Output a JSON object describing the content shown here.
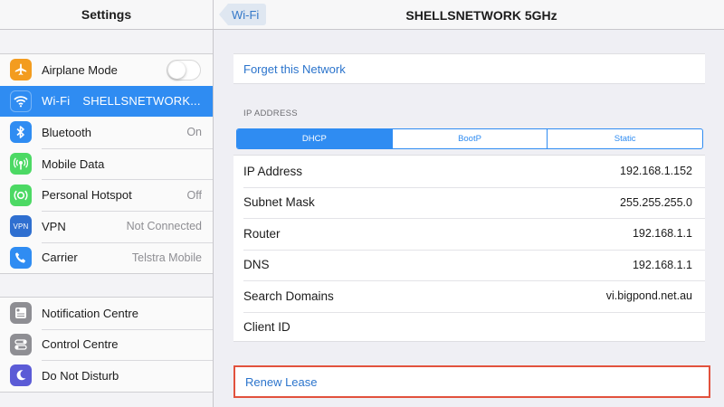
{
  "sidebar": {
    "title": "Settings",
    "group1": [
      {
        "label": "Airplane Mode",
        "icon": "airplane-icon",
        "color": "#f39c1f",
        "value": "",
        "toggle": true
      },
      {
        "label": "Wi-Fi",
        "icon": "wifi-icon",
        "color": "#2f8cf2",
        "value": "SHELLSNETWORK...",
        "selected": true
      },
      {
        "label": "Bluetooth",
        "icon": "bluetooth-icon",
        "color": "#2f8cf2",
        "value": "On"
      },
      {
        "label": "Mobile Data",
        "icon": "mobile-data-icon",
        "color": "#4cd964",
        "value": ""
      },
      {
        "label": "Personal Hotspot",
        "icon": "hotspot-icon",
        "color": "#4cd964",
        "value": "Off"
      },
      {
        "label": "VPN",
        "icon": "vpn-icon",
        "color": "#2f6fd0",
        "value": "Not Connected"
      },
      {
        "label": "Carrier",
        "icon": "phone-icon",
        "color": "#2f8cf2",
        "value": "Telstra Mobile"
      }
    ],
    "group2": [
      {
        "label": "Notification Centre",
        "icon": "notification-centre-icon",
        "color": "#8e8e93"
      },
      {
        "label": "Control Centre",
        "icon": "control-centre-icon",
        "color": "#8e8e93"
      },
      {
        "label": "Do Not Disturb",
        "icon": "moon-icon",
        "color": "#5b5bd6"
      }
    ]
  },
  "main": {
    "back_label": "Wi-Fi",
    "title": "SHELLSNETWORK 5GHz",
    "forget_label": "Forget this Network",
    "ip_section_label": "IP ADDRESS",
    "segments": [
      "DHCP",
      "BootP",
      "Static"
    ],
    "active_segment": "DHCP",
    "info_rows": [
      {
        "label": "IP Address",
        "value": "192.168.1.152"
      },
      {
        "label": "Subnet Mask",
        "value": "255.255.255.0"
      },
      {
        "label": "Router",
        "value": "192.168.1.1"
      },
      {
        "label": "DNS",
        "value": "192.168.1.1"
      },
      {
        "label": "Search Domains",
        "value": "vi.bigpond.net.au"
      },
      {
        "label": "Client ID",
        "value": ""
      }
    ],
    "renew_label": "Renew Lease",
    "highlight_color": "#e2523d"
  }
}
